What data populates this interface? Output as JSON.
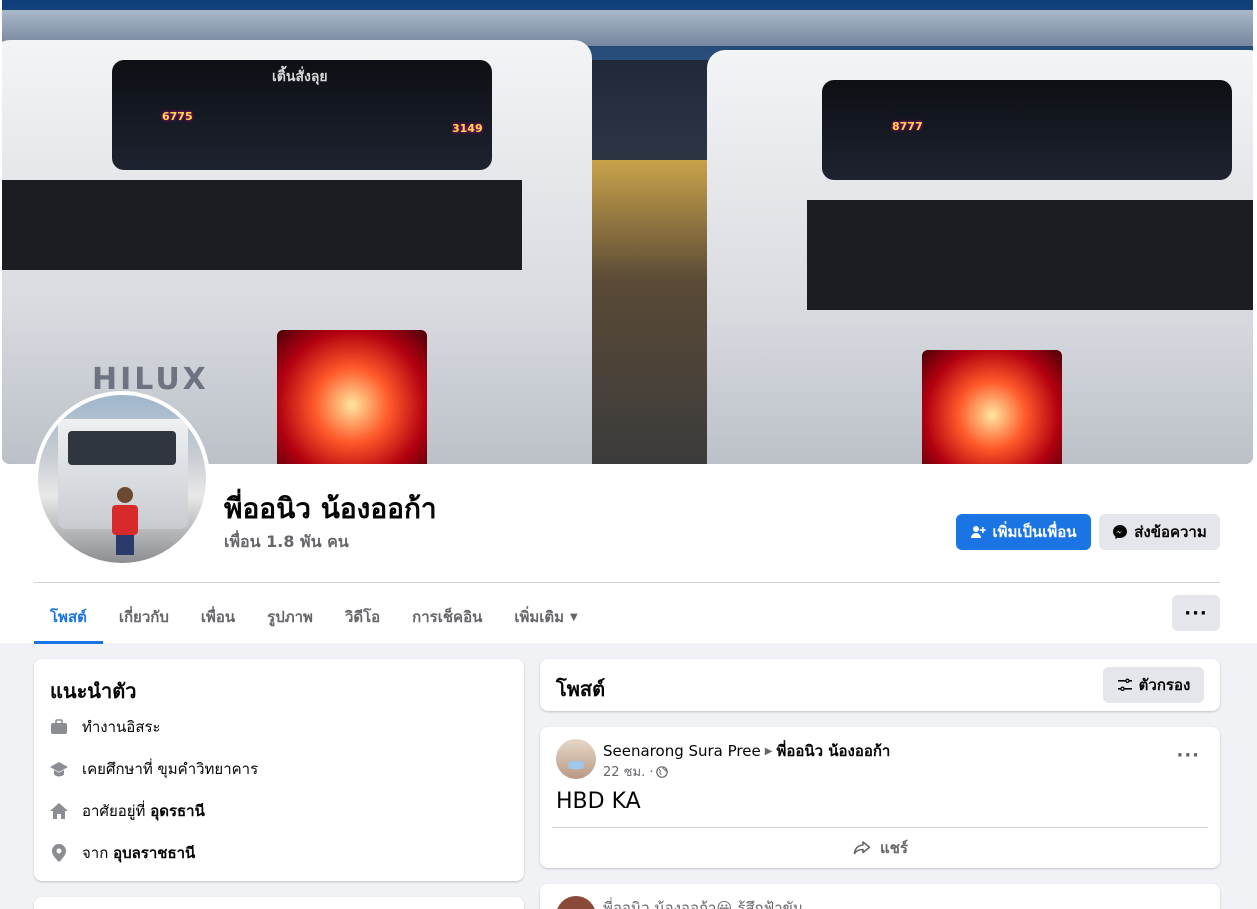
{
  "profile": {
    "name": "พี่ออนิว น้องออก้า",
    "friends_count": "เพื่อน 1.8 พัน คน"
  },
  "cover": {
    "sticker_left_1": "เติ้นสั่งลุย",
    "plate_left": "6775",
    "plate_left_2": "3149",
    "plate_right": "8777",
    "brand_text": "HILUX"
  },
  "actions": {
    "add_friend": "เพิ่มเป็นเพื่อน",
    "message": "ส่งข้อความ",
    "more": "···"
  },
  "tabs": [
    {
      "label": "โพสต์",
      "active": true
    },
    {
      "label": "เกี่ยวกับ"
    },
    {
      "label": "เพื่อน"
    },
    {
      "label": "รูปภาพ"
    },
    {
      "label": "วิดีโอ"
    },
    {
      "label": "การเช็คอิน"
    },
    {
      "label": "เพิ่มเติม"
    }
  ],
  "intro": {
    "title": "แนะนำตัว",
    "items": [
      {
        "icon": "briefcase-icon",
        "prefix": "ทำงานอิสระ",
        "bold": ""
      },
      {
        "icon": "graduation-cap-icon",
        "prefix": "เคยศึกษาที่ ขุมคำวิทยาคาร",
        "bold": ""
      },
      {
        "icon": "home-icon",
        "prefix": "อาศัยอยู่ที่ ",
        "bold": "อุดรธานี"
      },
      {
        "icon": "location-pin-icon",
        "prefix": "จาก ",
        "bold": "อุบลราชธานี"
      }
    ]
  },
  "posts_section": {
    "title": "โพสต์",
    "filter_label": "ตัวกรอง"
  },
  "post": {
    "author": "Seenarong Sura Pree",
    "target": "พี่ออนิว น้องออก้า",
    "time": "22 ชม. ·",
    "content": "HBD KA",
    "share_label": "แชร์"
  },
  "post2": {
    "author": "พี่ออนิว น้องออก้า😀",
    "status": "รู้สึกฟ้าขัน"
  },
  "colors": {
    "primary": "#1b74e4",
    "background": "#f0f2f5",
    "secondary_text": "#65676b"
  }
}
